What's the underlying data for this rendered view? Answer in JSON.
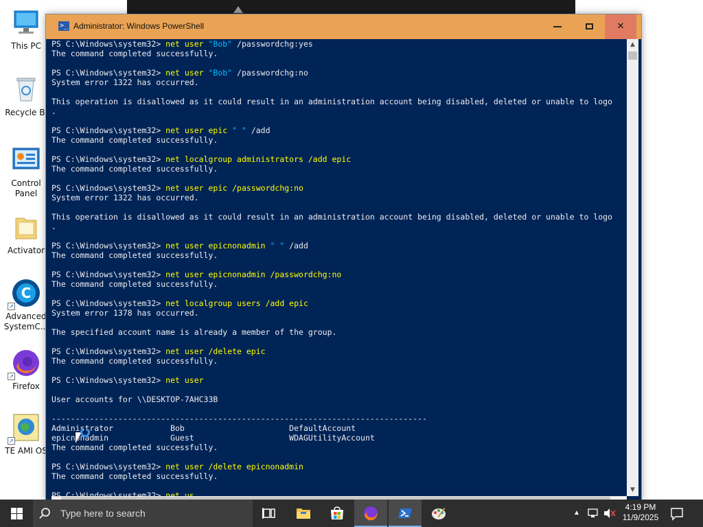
{
  "window": {
    "title": "Administrator: Windows PowerShell",
    "close_label": "✕"
  },
  "desktop_icons": [
    {
      "label": "This PC",
      "icon": "this-pc-icon"
    },
    {
      "label": "Recycle Bi",
      "icon": "recycle-bin-icon"
    },
    {
      "label": "Control\nPanel",
      "icon": "control-panel-icon"
    },
    {
      "label": "Activator",
      "icon": "folder-icon"
    },
    {
      "label": "Advanced\nSystemC...",
      "icon": "advanced-systemcare-icon"
    },
    {
      "label": "Firefox",
      "icon": "firefox-icon"
    },
    {
      "label": "TE AMI OS",
      "icon": "teami-os-icon"
    }
  ],
  "console_lines": [
    [
      {
        "t": "PS C:\\Windows\\system32> "
      },
      {
        "t": "net user ",
        "c": "cmd"
      },
      {
        "t": "\"Bob\"",
        "c": "str"
      },
      {
        "t": " /passwordchg:yes"
      }
    ],
    [
      {
        "t": "The command completed successfully."
      }
    ],
    [
      {
        "t": ""
      }
    ],
    [
      {
        "t": "PS C:\\Windows\\system32> "
      },
      {
        "t": "net user ",
        "c": "cmd"
      },
      {
        "t": "\"Bob\"",
        "c": "str"
      },
      {
        "t": " /passwordchg:no"
      }
    ],
    [
      {
        "t": "System error 1322 has occurred."
      }
    ],
    [
      {
        "t": ""
      }
    ],
    [
      {
        "t": "This operation is disallowed as it could result in an administration account being disabled, deleted or unable to logo"
      }
    ],
    [
      {
        "t": "."
      }
    ],
    [
      {
        "t": ""
      }
    ],
    [
      {
        "t": "PS C:\\Windows\\system32> "
      },
      {
        "t": "net user epic ",
        "c": "cmd"
      },
      {
        "t": "\" \"",
        "c": "str"
      },
      {
        "t": " /add"
      }
    ],
    [
      {
        "t": "The command completed successfully."
      }
    ],
    [
      {
        "t": ""
      }
    ],
    [
      {
        "t": "PS C:\\Windows\\system32> "
      },
      {
        "t": "net localgroup administrators /add epic",
        "c": "cmd"
      }
    ],
    [
      {
        "t": "The command completed successfully."
      }
    ],
    [
      {
        "t": ""
      }
    ],
    [
      {
        "t": "PS C:\\Windows\\system32> "
      },
      {
        "t": "net user epic /passwordchg:no",
        "c": "cmd"
      }
    ],
    [
      {
        "t": "System error 1322 has occurred."
      }
    ],
    [
      {
        "t": ""
      }
    ],
    [
      {
        "t": "This operation is disallowed as it could result in an administration account being disabled, deleted or unable to logo"
      }
    ],
    [
      {
        "t": "."
      }
    ],
    [
      {
        "t": ""
      }
    ],
    [
      {
        "t": "PS C:\\Windows\\system32> "
      },
      {
        "t": "net user epicnonadmin ",
        "c": "cmd"
      },
      {
        "t": "\" \"",
        "c": "str"
      },
      {
        "t": " /add"
      }
    ],
    [
      {
        "t": "The command completed successfully."
      }
    ],
    [
      {
        "t": ""
      }
    ],
    [
      {
        "t": "PS C:\\Windows\\system32> "
      },
      {
        "t": "net user epicnonadmin /passwordchg:no",
        "c": "cmd"
      }
    ],
    [
      {
        "t": "The command completed successfully."
      }
    ],
    [
      {
        "t": ""
      }
    ],
    [
      {
        "t": "PS C:\\Windows\\system32> "
      },
      {
        "t": "net localgroup users /add epic",
        "c": "cmd"
      }
    ],
    [
      {
        "t": "System error 1378 has occurred."
      }
    ],
    [
      {
        "t": ""
      }
    ],
    [
      {
        "t": "The specified account name is already a member of the group."
      }
    ],
    [
      {
        "t": ""
      }
    ],
    [
      {
        "t": "PS C:\\Windows\\system32> "
      },
      {
        "t": "net user /delete epic",
        "c": "cmd"
      }
    ],
    [
      {
        "t": "The command completed successfully."
      }
    ],
    [
      {
        "t": ""
      }
    ],
    [
      {
        "t": "PS C:\\Windows\\system32> "
      },
      {
        "t": "net user",
        "c": "cmd"
      }
    ],
    [
      {
        "t": ""
      }
    ],
    [
      {
        "t": "User accounts for \\\\DESKTOP-7AHC33B"
      }
    ],
    [
      {
        "t": ""
      }
    ],
    [
      {
        "t": "-------------------------------------------------------------------------------"
      }
    ],
    [
      {
        "t": "Administrator            Bob                      DefaultAccount"
      }
    ],
    [
      {
        "t": "epicnonadmin             Guest                    WDAGUtilityAccount"
      }
    ],
    [
      {
        "t": "The command completed successfully."
      }
    ],
    [
      {
        "t": ""
      }
    ],
    [
      {
        "t": "PS C:\\Windows\\system32> "
      },
      {
        "t": "net user /delete epicnonadmin",
        "c": "cmd"
      }
    ],
    [
      {
        "t": "The command completed successfully."
      }
    ],
    [
      {
        "t": ""
      }
    ],
    [
      {
        "t": "PS C:\\Windows\\system32> "
      },
      {
        "t": "net us",
        "c": "cmd"
      }
    ]
  ],
  "taskbar": {
    "search_placeholder": "Type here to search",
    "time": "4:19 PM",
    "date": "11/9/2025",
    "apps": [
      "task-view-icon",
      "file-explorer-icon",
      "store-icon",
      "firefox-icon",
      "powershell-icon",
      "paint-icon"
    ]
  },
  "colors": {
    "console_bg": "#012456",
    "command": "#ffff00",
    "string": "#00bfff",
    "titlebar": "#eaa355"
  }
}
